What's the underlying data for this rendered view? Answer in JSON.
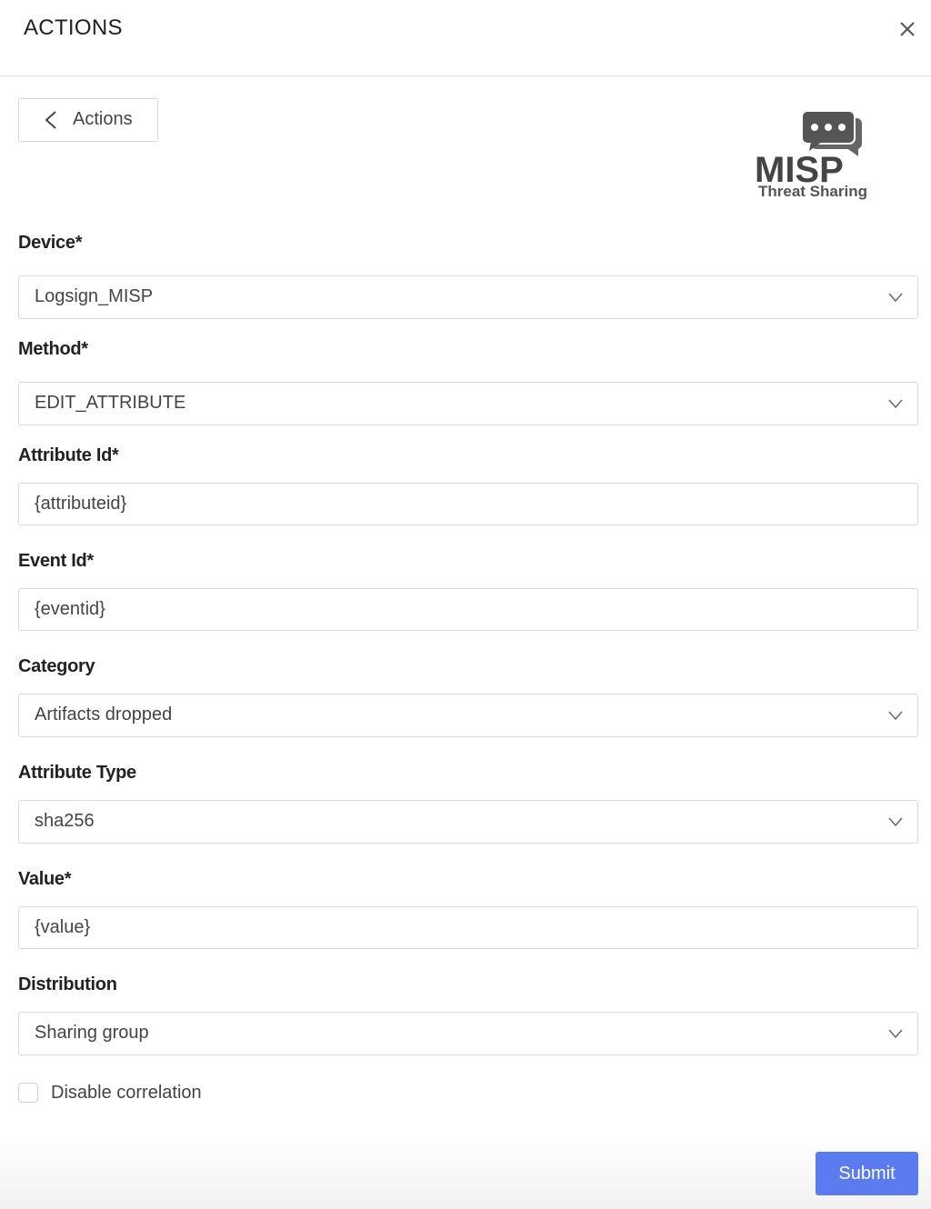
{
  "header": {
    "title": "ACTIONS",
    "close_icon": "close-icon"
  },
  "back_button": {
    "label": "Actions",
    "icon": "chevron-left-icon"
  },
  "logo": {
    "name": "MISP",
    "tagline": "Threat Sharing",
    "icon": "speech-bubbles-icon"
  },
  "form": {
    "device": {
      "label": "Device*",
      "value": "Logsign_MISP"
    },
    "method": {
      "label": "Method*",
      "value": "EDIT_ATTRIBUTE"
    },
    "attribute_id": {
      "label": "Attribute Id*",
      "value": "{attributeid}"
    },
    "event_id": {
      "label": "Event Id*",
      "value": "{eventid}"
    },
    "category": {
      "label": "Category",
      "value": "Artifacts dropped"
    },
    "attribute_type": {
      "label": "Attribute Type",
      "value": "sha256"
    },
    "value": {
      "label": "Value*",
      "value": "{value}"
    },
    "distribution": {
      "label": "Distribution",
      "value": "Sharing group"
    },
    "disable_correlation": {
      "label": "Disable correlation",
      "checked": false
    }
  },
  "submit": {
    "label": "Submit"
  },
  "colors": {
    "accent": "#5b7cf0",
    "border": "#d9d9d9",
    "logo_gray": "#555555"
  }
}
